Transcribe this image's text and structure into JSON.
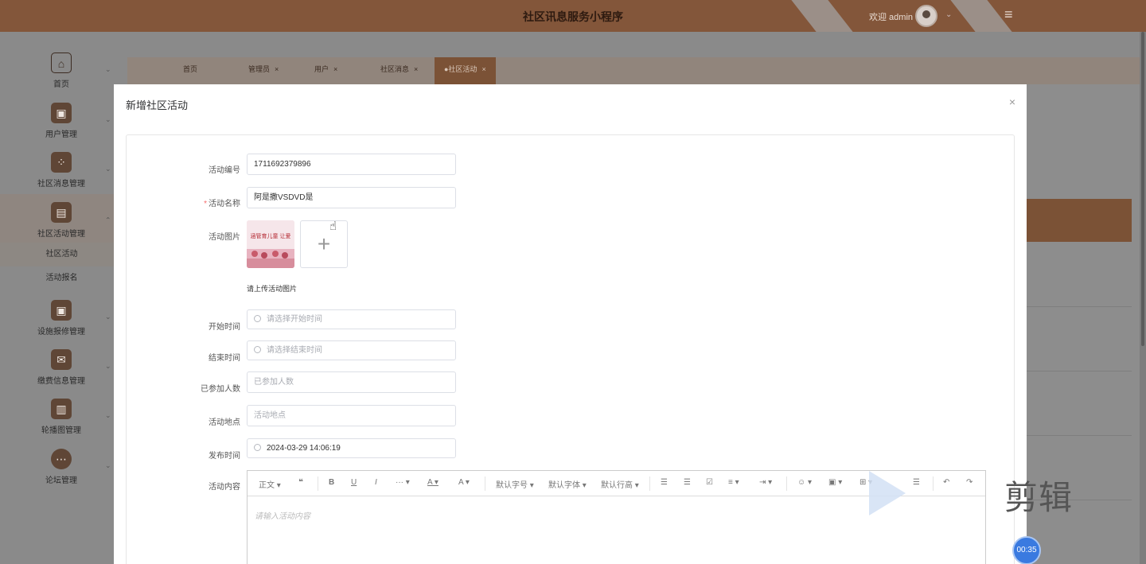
{
  "app": {
    "title": "社区讯息服务小程序",
    "welcome": "欢迎 admin",
    "user_caret": "⌄",
    "menu_icon": "≡"
  },
  "sidebar": {
    "items": [
      {
        "label": "首页",
        "icon": "home-icon",
        "glyph": "⌂"
      },
      {
        "label": "用户管理",
        "icon": "user-manage-icon",
        "glyph": "▣"
      },
      {
        "label": "社区消息管理",
        "icon": "grid-icon",
        "glyph": "⁘"
      },
      {
        "label": "社区活动管理",
        "icon": "layout-icon",
        "glyph": "▤"
      },
      {
        "label": "设施报修管理",
        "icon": "repair-icon",
        "glyph": "▣"
      },
      {
        "label": "缴费信息管理",
        "icon": "mail-icon",
        "glyph": "✉"
      },
      {
        "label": "轮播图管理",
        "icon": "carousel-icon",
        "glyph": "▥"
      },
      {
        "label": "论坛管理",
        "icon": "forum-icon",
        "glyph": "⋯"
      }
    ],
    "subitems": [
      "社区活动",
      "活动报名"
    ],
    "chevron": "⌄"
  },
  "tabs": [
    {
      "label": "首页",
      "close": ""
    },
    {
      "label": "管理员",
      "close": "×"
    },
    {
      "label": "用户",
      "close": "×"
    },
    {
      "label": "社区消息",
      "close": "×"
    },
    {
      "label": "●社区活动",
      "close": "×"
    }
  ],
  "modal": {
    "title": "新增社区活动",
    "close": "×",
    "fields": {
      "code": {
        "label": "活动编号",
        "value": "1711692379896"
      },
      "name": {
        "label": "活动名称",
        "required": "*",
        "value": "阿是撒VSDVD是"
      },
      "image": {
        "label": "活动图片",
        "add": "+",
        "tip": "请上传活动图片",
        "thumb_text": "涵管育儿童 让爱"
      },
      "start": {
        "label": "开始时间",
        "placeholder": "请选择开始时间"
      },
      "end": {
        "label": "结束时间",
        "placeholder": "请选择结束时间"
      },
      "joined": {
        "label": "已参加人数",
        "placeholder": "已参加人数"
      },
      "place": {
        "label": "活动地点",
        "placeholder": "活动地点"
      },
      "publish": {
        "label": "发布时间",
        "value": "2024-03-29 14:06:19"
      },
      "content": {
        "label": "活动内容",
        "placeholder": "请输入活动内容"
      }
    },
    "toolbar": [
      {
        "label": "正文 ▾",
        "name": "paragraph-select"
      },
      {
        "label": "❝",
        "name": "quote-button"
      },
      {
        "label": "B",
        "name": "bold-button"
      },
      {
        "label": "U",
        "name": "underline-button"
      },
      {
        "label": "I",
        "name": "italic-button"
      },
      {
        "label": "··· ▾",
        "name": "more-format-button"
      },
      {
        "label": "A ▾",
        "name": "font-color-button"
      },
      {
        "label": "A ▾",
        "name": "bg-color-button"
      },
      {
        "label": "默认字号 ▾",
        "name": "font-size-select"
      },
      {
        "label": "默认字体 ▾",
        "name": "font-family-select"
      },
      {
        "label": "默认行高 ▾",
        "name": "line-height-select"
      },
      {
        "label": "☰",
        "name": "bullet-list-button"
      },
      {
        "label": "☰",
        "name": "numbered-list-button"
      },
      {
        "label": "☑",
        "name": "todo-button"
      },
      {
        "label": "≡ ▾",
        "name": "align-button"
      },
      {
        "label": "⇥ ▾",
        "name": "indent-button"
      },
      {
        "label": "☺ ▾",
        "name": "emoji-button"
      },
      {
        "label": "▣ ▾",
        "name": "image-button"
      },
      {
        "label": "⊞ ▾",
        "name": "table-button"
      },
      {
        "label": "☰",
        "name": "divider-button"
      },
      {
        "label": "↶",
        "name": "undo-button"
      },
      {
        "label": "↷",
        "name": "redo-button"
      }
    ]
  },
  "overlay": {
    "watermark": "剪辑",
    "timer": "00:35"
  },
  "colors": {
    "brand": "#83563a",
    "active_tab": "#7b5236",
    "required": "#f56c6c",
    "timer": "#3a7ae0"
  }
}
